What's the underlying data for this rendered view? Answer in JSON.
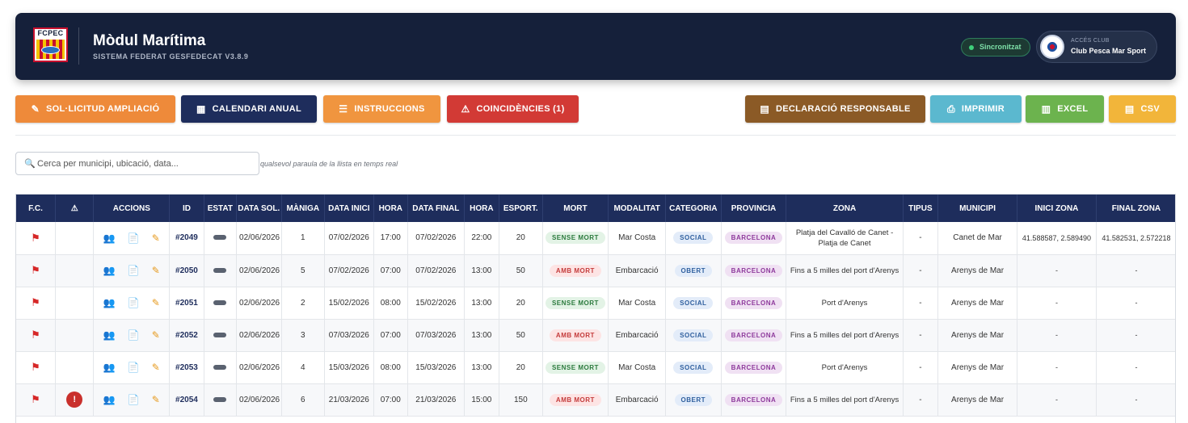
{
  "header": {
    "logo_text": "FCPEC",
    "title": "Mòdul Marítima",
    "subtitle": "SISTEMA FEDERAT GESFEDECAT V3.8.9",
    "sync_label": "Sincronitzat",
    "club_kicker": "ACCÉS CLUB",
    "club_name": "Club Pesca Mar Sport"
  },
  "toolbar": {
    "buttons": [
      {
        "label": "SOL·LICITUD AMPLIACIÓ",
        "icon": "edit-icon",
        "color": "#ee8a3a"
      },
      {
        "label": "CALENDARI ANUAL",
        "icon": "calendar-icon",
        "color": "#1e2d5c"
      },
      {
        "label": "INSTRUCCIONS",
        "icon": "book-icon",
        "color": "#f0953f"
      },
      {
        "label": "COINCIDÈNCIES (1)",
        "icon": "warning-icon",
        "color": "#d23a35"
      },
      {
        "label": "DECLARACIÓ RESPONSABLE",
        "icon": "document-icon",
        "color": "#8b5a26"
      },
      {
        "label": "IMPRIMIR",
        "icon": "printer-icon",
        "color": "#5bb8cf"
      },
      {
        "label": "EXCEL",
        "icon": "chart-icon",
        "color": "#6cb34e"
      },
      {
        "label": "CSV",
        "icon": "document-icon",
        "color": "#f2b53a"
      }
    ]
  },
  "search": {
    "placeholder": "Cerca per municipi, ubicació, data...",
    "hint": "qualsevol paraula de la llista en temps real"
  },
  "table": {
    "columns": [
      "F.C.",
      "⚠",
      "ACCIONS",
      "ID",
      "ESTAT",
      "DATA SOL.",
      "MÀNIGA",
      "DATA INICI",
      "HORA",
      "DATA FINAL",
      "HORA",
      "ESPORT.",
      "MORT",
      "MODALITAT",
      "CATEGORIA",
      "PROVINCIA",
      "ZONA",
      "TIPUS",
      "MUNICIPI",
      "INICI ZONA",
      "FINAL ZONA"
    ],
    "rows": [
      {
        "id": "#2049",
        "warning": "",
        "date_sol": "02/06/2026",
        "maniga": "1",
        "date_start": "07/02/2026",
        "time_start": "17:00",
        "date_end": "07/02/2026",
        "time_end": "22:00",
        "esport": "20",
        "mort": "SENSE MORT",
        "modalitat": "Mar Costa",
        "categoria": "SOCIAL",
        "provincia": "BARCELONA",
        "zona": "Platja del Cavalló de Canet - Platja de Canet",
        "tipus": "-",
        "municipi": "Canet de Mar",
        "inici_zona": "41.588587, 2.589490",
        "final_zona": "41.582531, 2.572218"
      },
      {
        "id": "#2050",
        "warning": "",
        "date_sol": "02/06/2026",
        "maniga": "5",
        "date_start": "07/02/2026",
        "time_start": "07:00",
        "date_end": "07/02/2026",
        "time_end": "13:00",
        "esport": "50",
        "mort": "AMB MORT",
        "modalitat": "Embarcació",
        "categoria": "OBERT",
        "provincia": "BARCELONA",
        "zona": "Fins a 5 milles del port d'Arenys",
        "tipus": "-",
        "municipi": "Arenys de Mar",
        "inici_zona": "-",
        "final_zona": "-"
      },
      {
        "id": "#2051",
        "warning": "",
        "date_sol": "02/06/2026",
        "maniga": "2",
        "date_start": "15/02/2026",
        "time_start": "08:00",
        "date_end": "15/02/2026",
        "time_end": "13:00",
        "esport": "20",
        "mort": "SENSE MORT",
        "modalitat": "Mar Costa",
        "categoria": "SOCIAL",
        "provincia": "BARCELONA",
        "zona": "Port d'Arenys",
        "tipus": "-",
        "municipi": "Arenys de Mar",
        "inici_zona": "-",
        "final_zona": "-"
      },
      {
        "id": "#2052",
        "warning": "",
        "date_sol": "02/06/2026",
        "maniga": "3",
        "date_start": "07/03/2026",
        "time_start": "07:00",
        "date_end": "07/03/2026",
        "time_end": "13:00",
        "esport": "50",
        "mort": "AMB MORT",
        "modalitat": "Embarcació",
        "categoria": "SOCIAL",
        "provincia": "BARCELONA",
        "zona": "Fins a 5 milles del port d'Arenys",
        "tipus": "-",
        "municipi": "Arenys de Mar",
        "inici_zona": "-",
        "final_zona": "-"
      },
      {
        "id": "#2053",
        "warning": "",
        "date_sol": "02/06/2026",
        "maniga": "4",
        "date_start": "15/03/2026",
        "time_start": "08:00",
        "date_end": "15/03/2026",
        "time_end": "13:00",
        "esport": "20",
        "mort": "SENSE MORT",
        "modalitat": "Mar Costa",
        "categoria": "SOCIAL",
        "provincia": "BARCELONA",
        "zona": "Port d'Arenys",
        "tipus": "-",
        "municipi": "Arenys de Mar",
        "inici_zona": "-",
        "final_zona": "-"
      },
      {
        "id": "#2054",
        "warning": "!",
        "date_sol": "02/06/2026",
        "maniga": "6",
        "date_start": "21/03/2026",
        "time_start": "07:00",
        "date_end": "21/03/2026",
        "time_end": "15:00",
        "esport": "150",
        "mort": "AMB MORT",
        "modalitat": "Embarcació",
        "categoria": "OBERT",
        "provincia": "BARCELONA",
        "zona": "Fins a 5 milles del port d'Arenys",
        "tipus": "-",
        "municipi": "Arenys de Mar",
        "inici_zona": "-",
        "final_zona": "-"
      }
    ]
  }
}
